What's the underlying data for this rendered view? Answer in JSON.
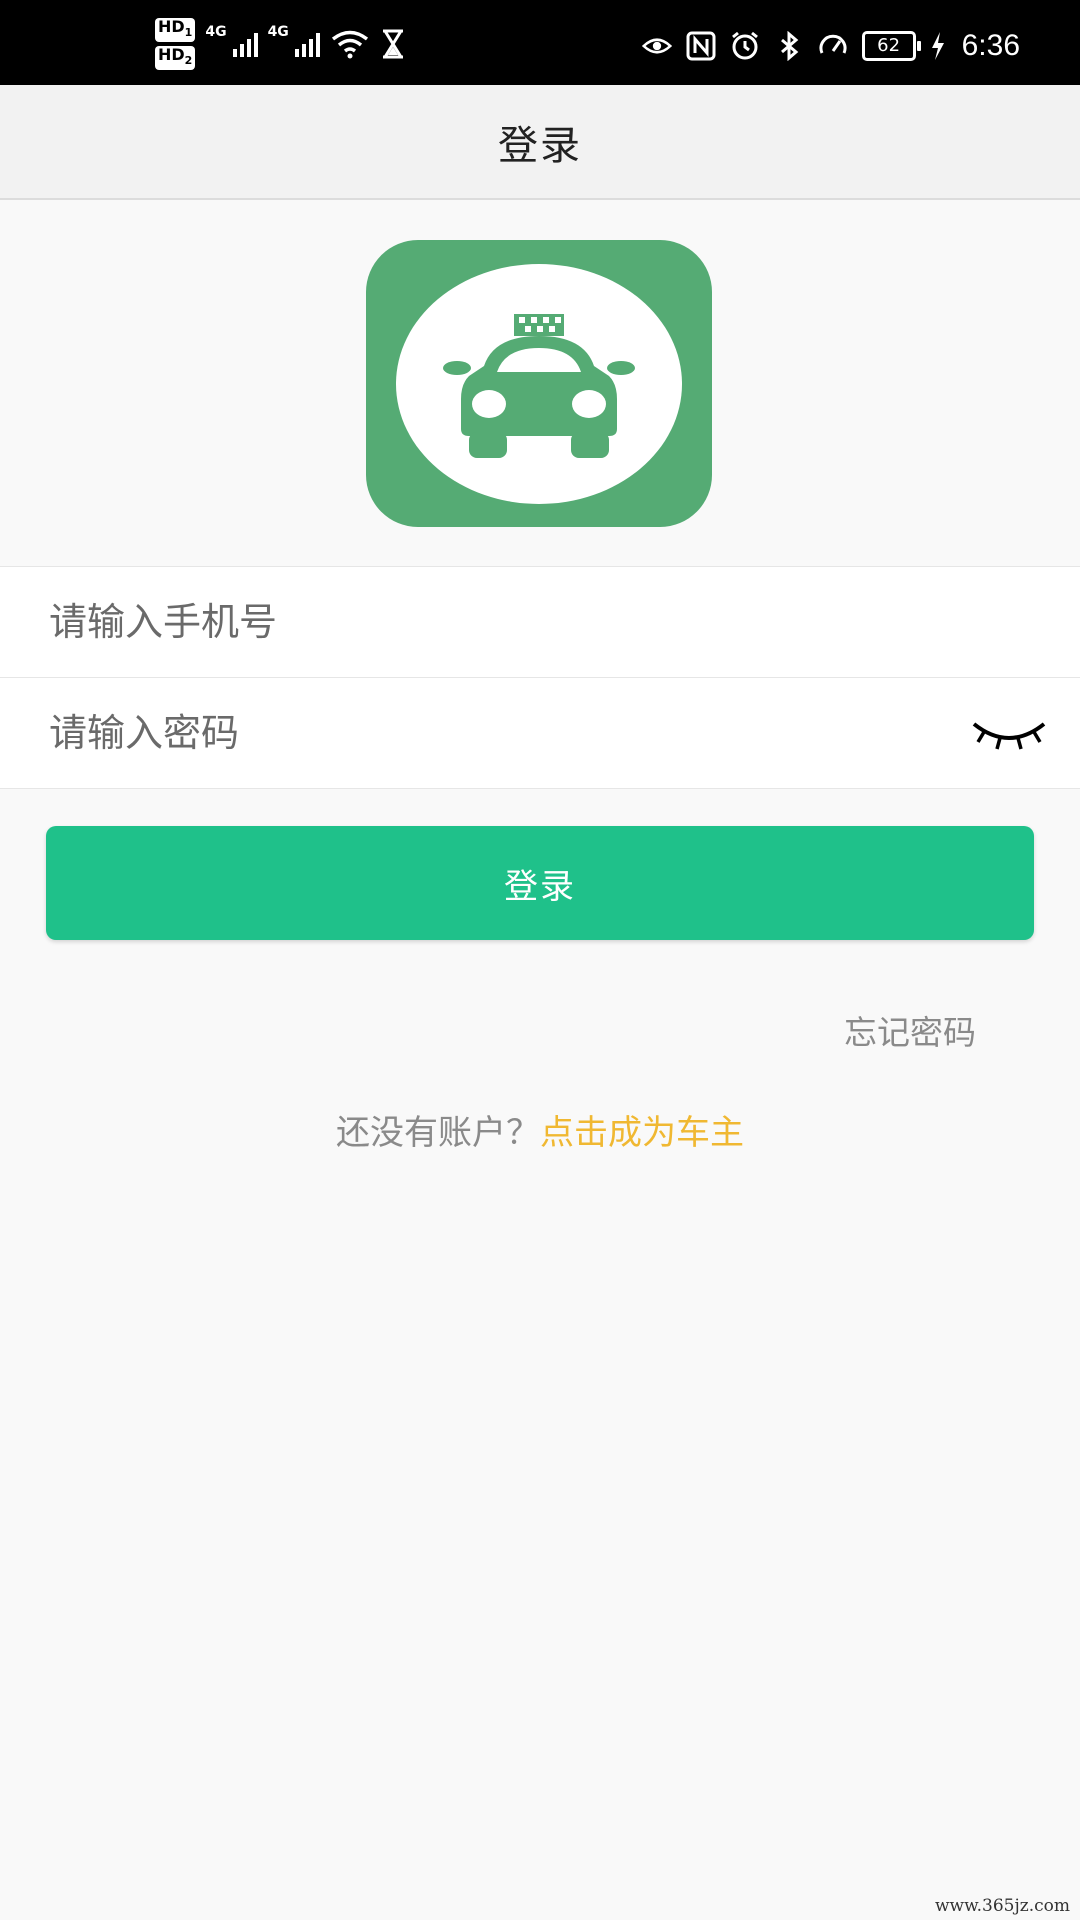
{
  "status_bar": {
    "hd1": "HD",
    "hd1_sim": "1",
    "hd2": "HD",
    "hd2_sim": "2",
    "network1": "4G",
    "network2": "4G",
    "battery": "62",
    "time": "6:36"
  },
  "header": {
    "title": "登录"
  },
  "form": {
    "phone_placeholder": "请输入手机号",
    "phone_value": "",
    "password_placeholder": "请输入密码",
    "password_value": ""
  },
  "login_button": "登录",
  "forgot_password": "忘记密码",
  "register": {
    "question": "还没有账户？",
    "link": "点击成为车主"
  },
  "watermark": "www.365jz.com",
  "colors": {
    "primary": "#1fc18a",
    "logo": "#55ab74",
    "link": "#f0b832"
  },
  "icons": [
    "eye-icon",
    "car-icon",
    "wifi-icon",
    "alarm-icon",
    "bluetooth-icon",
    "nfc-icon"
  ]
}
